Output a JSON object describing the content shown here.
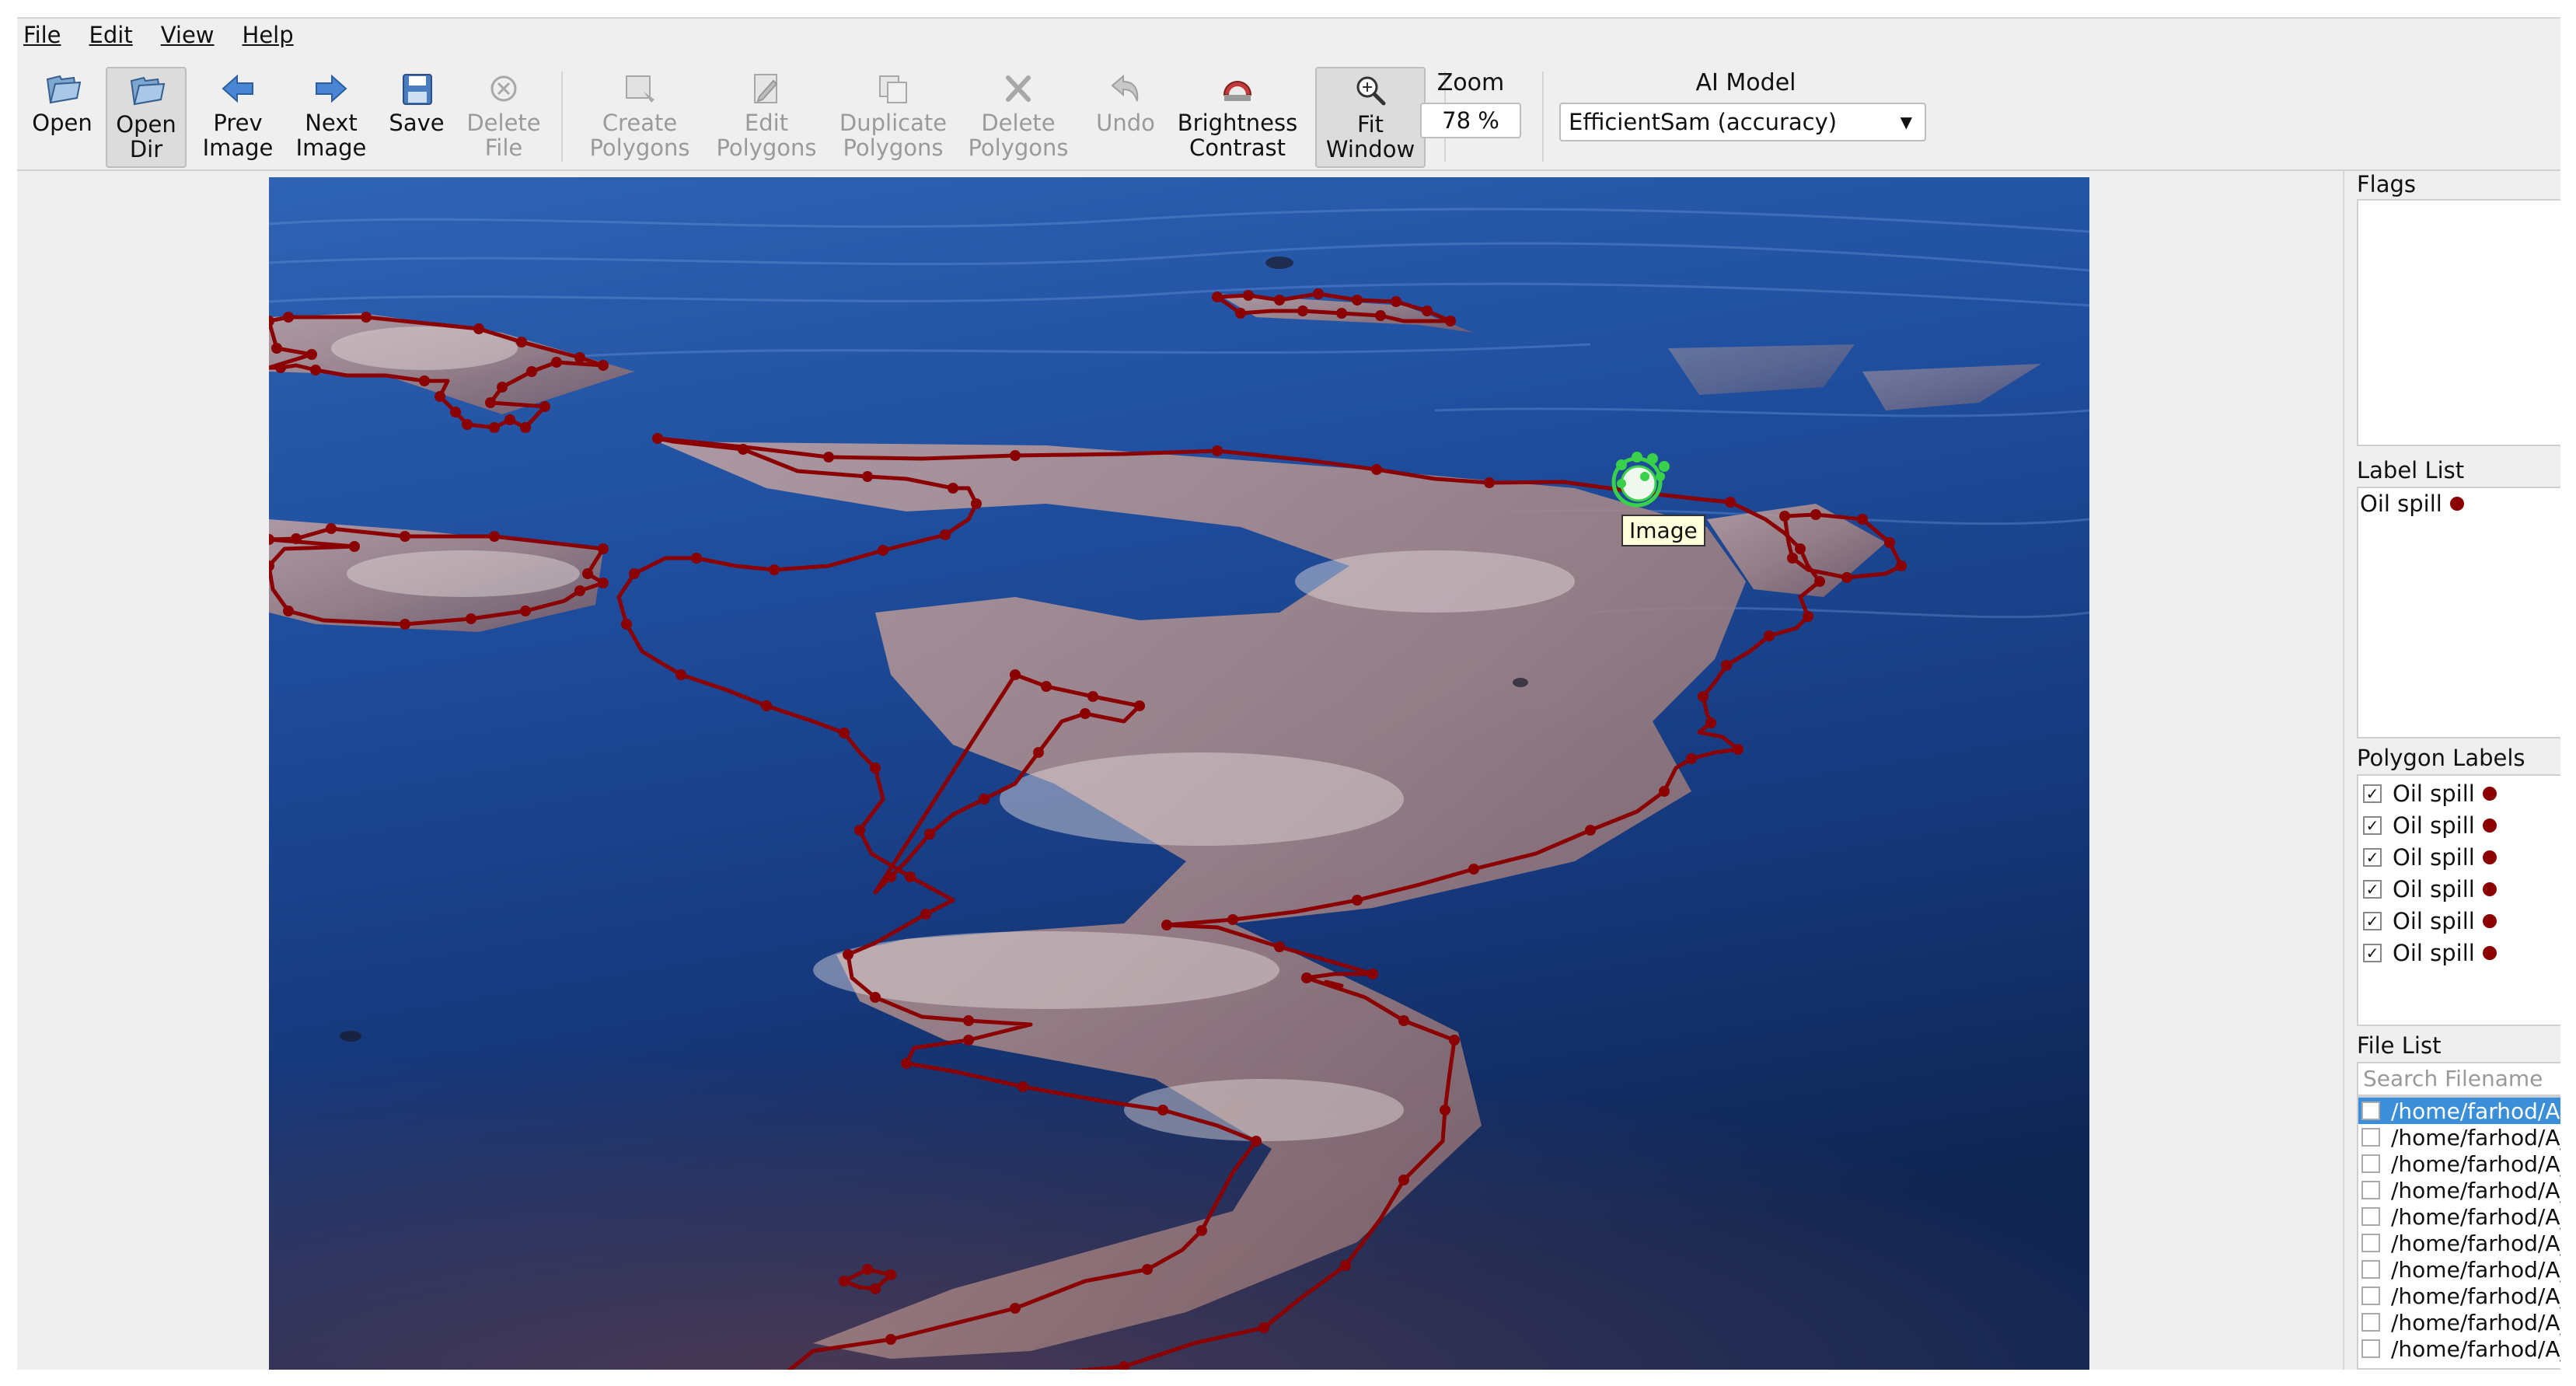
{
  "menu": [
    {
      "label": "File"
    },
    {
      "label": "Edit"
    },
    {
      "label": "View"
    },
    {
      "label": "Help"
    }
  ],
  "toolbar": {
    "open": {
      "label": "Open",
      "icon": "folder-open-icon"
    },
    "open_dir": {
      "label": "Open\nDir",
      "icon": "folder-open-icon"
    },
    "prev_image": {
      "label": "Prev\nImage",
      "icon": "arrow-left-icon"
    },
    "next_image": {
      "label": "Next\nImage",
      "icon": "arrow-right-icon"
    },
    "save": {
      "label": "Save",
      "icon": "floppy-disk-icon"
    },
    "delete_file": {
      "label": "Delete\nFile",
      "icon": "delete-circle-icon"
    },
    "create_polygons": {
      "label": "Create\nPolygons",
      "icon": "polygon-create-icon"
    },
    "edit_polygons": {
      "label": "Edit\nPolygons",
      "icon": "pencil-edit-icon"
    },
    "duplicate_polygons": {
      "label": "Duplicate\nPolygons",
      "icon": "copy-icon"
    },
    "delete_polygons": {
      "label": "Delete\nPolygons",
      "icon": "cross-icon"
    },
    "undo": {
      "label": "Undo",
      "icon": "undo-arrow-icon"
    },
    "brightness_contrast": {
      "label": "Brightness\nContrast",
      "icon": "brightness-icon"
    },
    "fit_window": {
      "label": "Fit\nWindow",
      "icon": "zoom-fit-icon"
    }
  },
  "zoom": {
    "title": "Zoom",
    "value": "78 %"
  },
  "ai_model": {
    "title": "AI Model",
    "selected": "EfficientSam (accuracy)"
  },
  "canvas": {
    "tooltip": "Image",
    "polygon_color": "#8b0000"
  },
  "dock": {
    "flags_title": "Flags",
    "label_list_title": "Label List",
    "label_list": [
      {
        "label": "Oil spill",
        "color": "#8b0000"
      }
    ],
    "polygon_labels_title": "Polygon Labels",
    "polygon_labels": [
      {
        "label": "Oil spill",
        "checked": "✓"
      },
      {
        "label": "Oil spill",
        "checked": "✓"
      },
      {
        "label": "Oil spill",
        "checked": "✓"
      },
      {
        "label": "Oil spill",
        "checked": "✓"
      },
      {
        "label": "Oil spill",
        "checked": "✓"
      },
      {
        "label": "Oil spill",
        "checked": "✓"
      }
    ],
    "file_list_title": "File List",
    "search_placeholder": "Search Filename",
    "files": [
      "/home/farhod/A",
      "/home/farhod/A_",
      "/home/farhod/A_",
      "/home/farhod/A_",
      "/home/farhod/A_",
      "/home/farhod/A_",
      "/home/farhod/A_",
      "/home/farhod/A_",
      "/home/farhod/A_",
      "/home/farhod/A_"
    ]
  }
}
